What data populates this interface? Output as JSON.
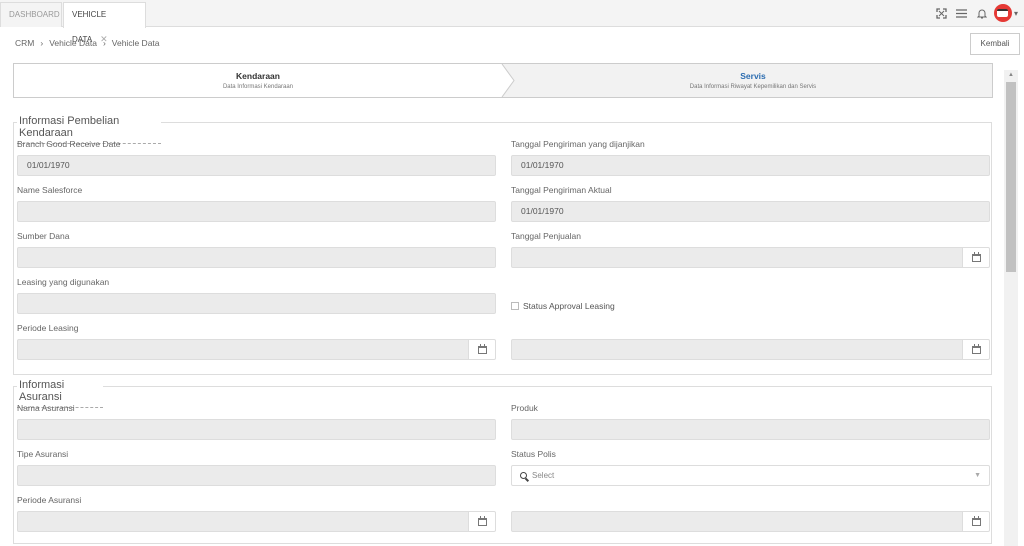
{
  "tabs": [
    {
      "label": "DASHBOARD"
    },
    {
      "label": "VEHICLE DATA",
      "close": "✕"
    }
  ],
  "breadcrumb": {
    "root": "CRM",
    "sep": "›",
    "parent": "Vehicle Data",
    "current": "Vehicle Data"
  },
  "back_button": "Kembali",
  "steps": [
    {
      "title": "Kendaraan",
      "subtitle": "Data Informasi Kendaraan"
    },
    {
      "title": "Servis",
      "subtitle": "Data Informasi Riwayat Kepemilikan dan Servis"
    }
  ],
  "purchase": {
    "legend": "Informasi Pembelian Kendaraan",
    "branch_good_receive_date": {
      "label": "Branch Good Receive Date",
      "value": "01/01/1970"
    },
    "promised_delivery_date": {
      "label": "Tanggal Pengiriman yang dijanjikan",
      "value": "01/01/1970"
    },
    "salesforce_name": {
      "label": "Name Salesforce",
      "value": ""
    },
    "actual_delivery_date": {
      "label": "Tanggal Pengiriman Aktual",
      "value": "01/01/1970"
    },
    "fund_source": {
      "label": "Sumber Dana",
      "value": ""
    },
    "sale_date": {
      "label": "Tanggal Penjualan",
      "value": ""
    },
    "leasing_used": {
      "label": "Leasing yang digunakan",
      "value": ""
    },
    "leasing_approval": {
      "label": "Status Approval Leasing"
    },
    "leasing_period": {
      "label": "Periode Leasing",
      "start": "",
      "end": ""
    }
  },
  "insurance": {
    "legend": "Informasi Asuransi",
    "name": {
      "label": "Nama Asuransi",
      "value": ""
    },
    "product": {
      "label": "Produk",
      "value": ""
    },
    "type": {
      "label": "Tipe Asuransi",
      "value": ""
    },
    "policy_status": {
      "label": "Status Polis",
      "placeholder": "Select"
    },
    "period": {
      "label": "Periode Asuransi",
      "start": "",
      "end": ""
    }
  },
  "icons": {
    "fullscreen": "fullscreen-icon",
    "menu": "menu-icon",
    "bell": "bell-icon",
    "calendar": "calendar-icon",
    "search": "search-icon",
    "chevron": "chevron-down-icon"
  },
  "colors": {
    "accent_blue": "#2b6cb0",
    "avatar_red": "#e53935"
  }
}
